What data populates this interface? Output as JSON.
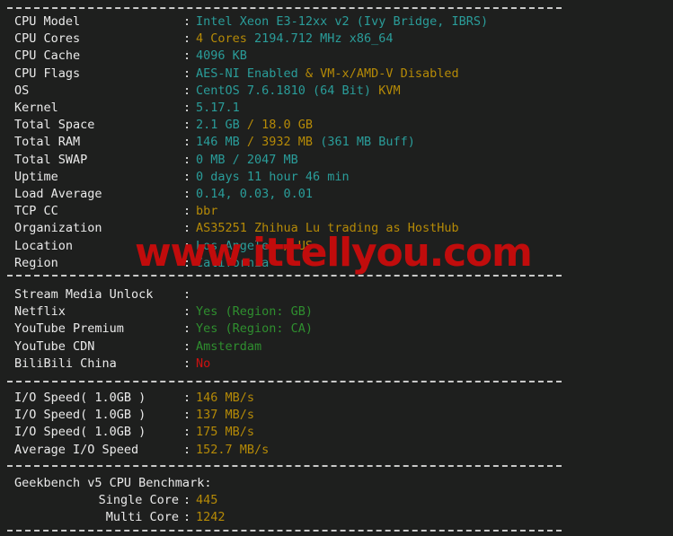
{
  "terminal": {
    "background_color": "#1e1f1e",
    "label_color": "#eaeaea",
    "cyan": "#2a9d9a",
    "orange": "#b58a07",
    "green": "#2f8f2f",
    "red": "#cc1111",
    "separator": "--------------------------------------------------------------------"
  },
  "watermark": {
    "text": "www.ittellyou.com",
    "color": "#c10c0c"
  },
  "system_info": {
    "rows": [
      {
        "label": "CPU Model",
        "colon": ":",
        "parts": [
          {
            "text": "Intel Xeon E3-12xx v2 (Ivy Bridge, IBRS)",
            "color": "cyan"
          }
        ]
      },
      {
        "label": "CPU Cores",
        "colon": ":",
        "parts": [
          {
            "text": "4 Cores ",
            "color": "orange"
          },
          {
            "text": "2194.712 MHz x86_64",
            "color": "cyan"
          }
        ]
      },
      {
        "label": "CPU Cache",
        "colon": ":",
        "parts": [
          {
            "text": "4096 KB",
            "color": "cyan"
          }
        ]
      },
      {
        "label": "CPU Flags",
        "colon": ":",
        "parts": [
          {
            "text": "AES-NI Enabled ",
            "color": "cyan"
          },
          {
            "text": "& VM-x/AMD-V Disabled",
            "color": "orange"
          }
        ]
      },
      {
        "label": "OS",
        "colon": ":",
        "parts": [
          {
            "text": "CentOS 7.6.1810 (64 Bit) ",
            "color": "cyan"
          },
          {
            "text": "KVM",
            "color": "orange"
          }
        ]
      },
      {
        "label": "Kernel",
        "colon": ":",
        "parts": [
          {
            "text": "5.17.1",
            "color": "cyan"
          }
        ]
      },
      {
        "label": "Total Space",
        "colon": ":",
        "parts": [
          {
            "text": "2.1 GB ",
            "color": "cyan"
          },
          {
            "text": "/ 18.0 GB",
            "color": "orange"
          }
        ]
      },
      {
        "label": "Total RAM",
        "colon": ":",
        "parts": [
          {
            "text": "146 MB ",
            "color": "cyan"
          },
          {
            "text": "/ 3932 MB ",
            "color": "orange"
          },
          {
            "text": "(361 MB Buff)",
            "color": "cyan"
          }
        ]
      },
      {
        "label": "Total SWAP",
        "colon": ":",
        "parts": [
          {
            "text": "0 MB / 2047 MB",
            "color": "cyan"
          }
        ]
      },
      {
        "label": "Uptime",
        "colon": ":",
        "parts": [
          {
            "text": "0 days 11 hour 46 min",
            "color": "cyan"
          }
        ]
      },
      {
        "label": "Load Average",
        "colon": ":",
        "parts": [
          {
            "text": "0.14, 0.03, 0.01",
            "color": "cyan"
          }
        ]
      },
      {
        "label": "TCP CC",
        "colon": ":",
        "parts": [
          {
            "text": "bbr",
            "color": "orange"
          }
        ]
      },
      {
        "label": "Organization",
        "colon": ":",
        "parts": [
          {
            "text": "AS35251 Zhihua Lu trading as HostHub",
            "color": "orange"
          }
        ]
      },
      {
        "label": "Location",
        "colon": ":",
        "parts": [
          {
            "text": "Los Angeles ",
            "color": "cyan"
          },
          {
            "text": "/ US",
            "color": "orange"
          }
        ]
      },
      {
        "label": "Region",
        "colon": ":",
        "parts": [
          {
            "text": "California",
            "color": "cyan"
          }
        ]
      }
    ]
  },
  "stream_media": {
    "rows": [
      {
        "label": "Stream Media Unlock",
        "colon": ":",
        "parts": []
      },
      {
        "label": "Netflix",
        "colon": ":",
        "parts": [
          {
            "text": "Yes (Region: GB)",
            "color": "green"
          }
        ]
      },
      {
        "label": "YouTube Premium",
        "colon": ":",
        "parts": [
          {
            "text": "Yes (Region: CA)",
            "color": "green"
          }
        ]
      },
      {
        "label": "YouTube CDN",
        "colon": ":",
        "parts": [
          {
            "text": "Amsterdam",
            "color": "green"
          }
        ]
      },
      {
        "label": "BiliBili China",
        "colon": ":",
        "parts": [
          {
            "text": "No",
            "color": "red"
          }
        ]
      }
    ]
  },
  "io_speed": {
    "rows": [
      {
        "label": "I/O Speed( 1.0GB )",
        "colon": ":",
        "parts": [
          {
            "text": "146 MB/s",
            "color": "orange"
          }
        ]
      },
      {
        "label": "I/O Speed( 1.0GB )",
        "colon": ":",
        "parts": [
          {
            "text": "137 MB/s",
            "color": "orange"
          }
        ]
      },
      {
        "label": "I/O Speed( 1.0GB )",
        "colon": ":",
        "parts": [
          {
            "text": "175 MB/s",
            "color": "orange"
          }
        ]
      },
      {
        "label": "Average I/O Speed",
        "colon": ":",
        "parts": [
          {
            "text": "152.7 MB/s",
            "color": "orange"
          }
        ]
      }
    ]
  },
  "geekbench": {
    "heading": "Geekbench v5 CPU Benchmark:",
    "rows": [
      {
        "label": "Single Core",
        "colon": ":",
        "indent": true,
        "parts": [
          {
            "text": "445",
            "color": "orange"
          }
        ]
      },
      {
        "label": "Multi Core",
        "colon": ":",
        "indent": true,
        "parts": [
          {
            "text": "1242",
            "color": "orange"
          }
        ]
      }
    ]
  }
}
